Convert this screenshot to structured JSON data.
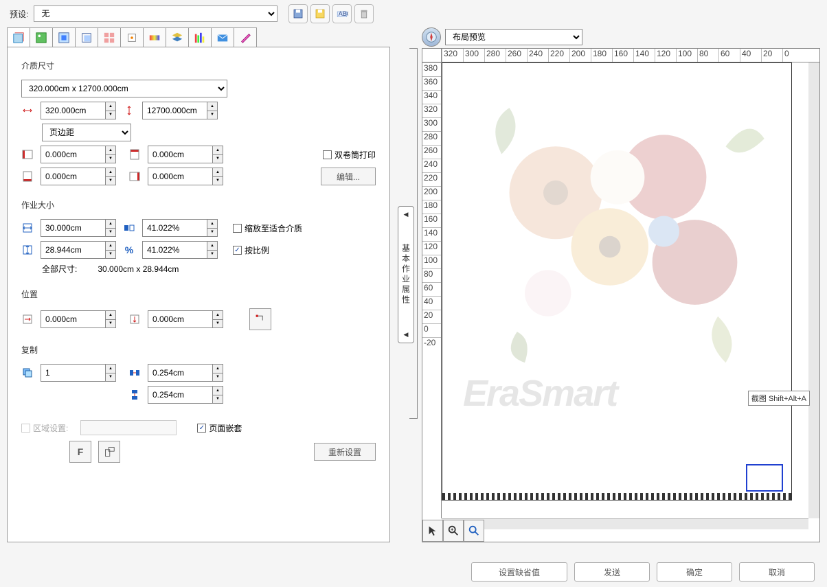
{
  "topbar": {
    "preset_label": "预设:",
    "preset_value": "无"
  },
  "vertical_tab": "基本作业属性",
  "media": {
    "title": "介质尺寸",
    "size_select": "320.000cm x 12700.000cm",
    "width": "320.000cm",
    "height": "12700.000cm",
    "margin_select": "页边距",
    "m_left": "0.000cm",
    "m_top": "0.000cm",
    "m_bottom": "0.000cm",
    "m_right": "0.000cm",
    "dual_reel": "双卷筒打印",
    "edit": "编辑..."
  },
  "job": {
    "title": "作业大小",
    "w": "30.000cm",
    "wp": "41.022%",
    "h": "28.944cm",
    "hp": "41.022%",
    "fit_chk": "缩放至适合介质",
    "ratio_chk": "按比例",
    "fullsize_label": "全部尺寸:",
    "fullsize_value": "30.000cm x 28.944cm"
  },
  "pos": {
    "title": "位置",
    "x": "0.000cm",
    "y": "0.000cm"
  },
  "copy": {
    "title": "复制",
    "count": "1",
    "gap_h": "0.254cm",
    "gap_v": "0.254cm"
  },
  "bottom": {
    "region": "区域设置:",
    "nest": "页面嵌套",
    "reset": "重新设置"
  },
  "right": {
    "preview_select": "布局预览",
    "watermark": "EraSmart",
    "tooltip": "截图 Shift+Alt+A"
  },
  "ruler_h": [
    "320",
    "300",
    "280",
    "260",
    "240",
    "220",
    "200",
    "180",
    "160",
    "140",
    "120",
    "100",
    "80",
    "60",
    "40",
    "20",
    "0"
  ],
  "ruler_v": [
    "380",
    "360",
    "340",
    "320",
    "300",
    "280",
    "260",
    "240",
    "220",
    "200",
    "180",
    "160",
    "140",
    "120",
    "100",
    "80",
    "60",
    "40",
    "20",
    "0",
    "-20"
  ],
  "footer": {
    "default": "设置缺省值",
    "send": "发送",
    "ok": "确定",
    "cancel": "取消"
  }
}
